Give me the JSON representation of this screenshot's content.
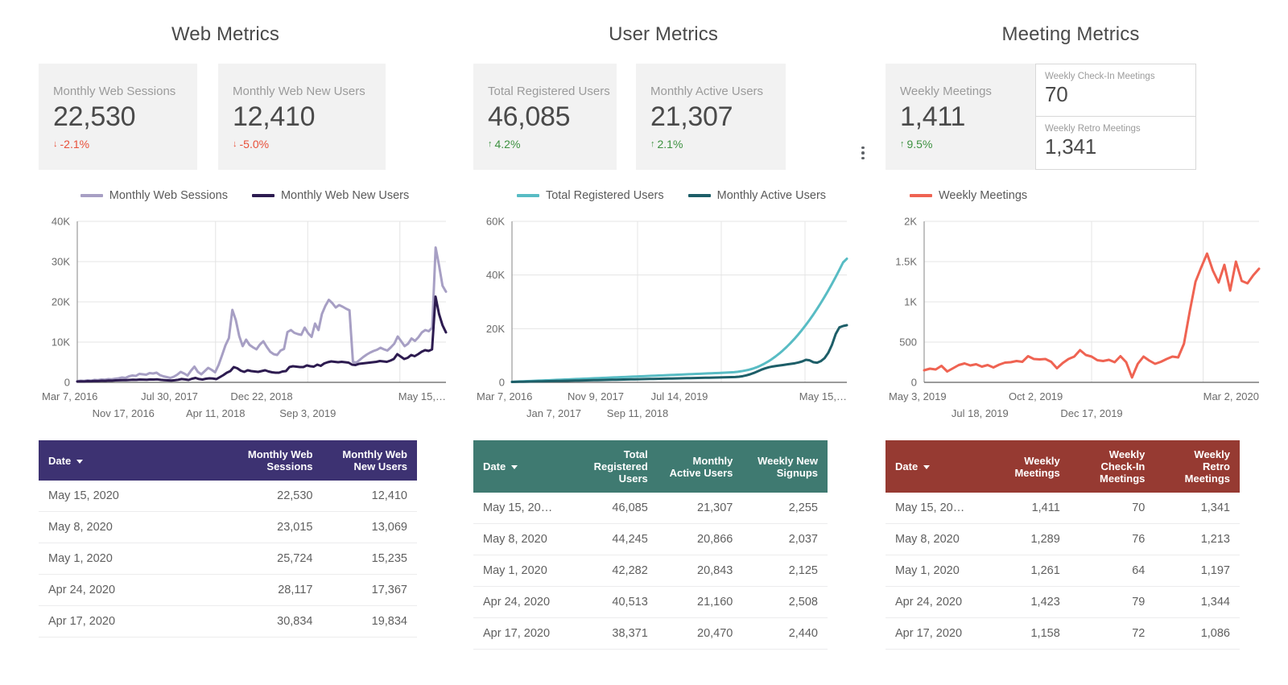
{
  "panels": [
    {
      "title": "Web Metrics",
      "scorecards": [
        {
          "label": "Monthly Web Sessions",
          "value": "22,530",
          "delta": "-2.1%",
          "direction": "down",
          "arrow": "↓"
        },
        {
          "label": "Monthly Web New Users",
          "value": "12,410",
          "delta": "-5.0%",
          "direction": "down",
          "arrow": "↓"
        }
      ],
      "legend": [
        {
          "label": "Monthly Web Sessions",
          "color": "#a79fc4"
        },
        {
          "label": "Monthly Web New Users",
          "color": "#2d1b50"
        }
      ],
      "table": {
        "header_color": "#3d3272",
        "columns": [
          "Date",
          "Monthly Web Sessions",
          "Monthly Web New Users"
        ],
        "rows": [
          [
            "May 15, 2020",
            "22,530",
            "12,410"
          ],
          [
            "May 8, 2020",
            "23,015",
            "13,069"
          ],
          [
            "May 1, 2020",
            "25,724",
            "15,235"
          ],
          [
            "Apr 24, 2020",
            "28,117",
            "17,367"
          ],
          [
            "Apr 17, 2020",
            "30,834",
            "19,834"
          ]
        ]
      }
    },
    {
      "title": "User Metrics",
      "scorecards": [
        {
          "label": "Total Registered Users",
          "value": "46,085",
          "delta": "4.2%",
          "direction": "up",
          "arrow": "↑"
        },
        {
          "label": "Monthly Active Users",
          "value": "21,307",
          "delta": "2.1%",
          "direction": "up",
          "arrow": "↑"
        }
      ],
      "legend": [
        {
          "label": "Total Registered Users",
          "color": "#58bcc4"
        },
        {
          "label": "Monthly Active Users",
          "color": "#1d5e68"
        }
      ],
      "table": {
        "header_color": "#3f7a71",
        "columns": [
          "Date",
          "Total Registered Users",
          "Monthly Active Users",
          "Weekly New Signups"
        ],
        "rows": [
          [
            "May 15, 20…",
            "46,085",
            "21,307",
            "2,255"
          ],
          [
            "May 8, 2020",
            "44,245",
            "20,866",
            "2,037"
          ],
          [
            "May 1, 2020",
            "42,282",
            "20,843",
            "2,125"
          ],
          [
            "Apr 24, 2020",
            "40,513",
            "21,160",
            "2,508"
          ],
          [
            "Apr 17, 2020",
            "38,371",
            "20,470",
            "2,440"
          ]
        ]
      }
    },
    {
      "title": "Meeting Metrics",
      "scorecards": [
        {
          "label": "Weekly Meetings",
          "value": "1,411",
          "delta": "9.5%",
          "direction": "up",
          "arrow": "↑"
        }
      ],
      "mini_cards": [
        {
          "label": "Weekly Check-In Meetings",
          "value": "70"
        },
        {
          "label": "Weekly Retro Meetings",
          "value": "1,341"
        }
      ],
      "legend": [
        {
          "label": "Weekly Meetings",
          "color": "#ef6352"
        }
      ],
      "table": {
        "header_color": "#963a32",
        "columns": [
          "Date",
          "Weekly Meetings",
          "Weekly Check-In Meetings",
          "Weekly Retro Meetings"
        ],
        "rows": [
          [
            "May 15, 20…",
            "1,411",
            "70",
            "1,341"
          ],
          [
            "May 8, 2020",
            "1,289",
            "76",
            "1,213"
          ],
          [
            "May 1, 2020",
            "1,261",
            "64",
            "1,197"
          ],
          [
            "Apr 24, 2020",
            "1,423",
            "79",
            "1,344"
          ],
          [
            "Apr 17, 2020",
            "1,158",
            "72",
            "1,086"
          ]
        ]
      }
    }
  ],
  "chart_data": [
    {
      "type": "line",
      "title": "Web Metrics",
      "xlabel": "",
      "ylabel": "",
      "ylim": [
        0,
        40000
      ],
      "yticks": [
        "0",
        "10K",
        "20K",
        "30K",
        "40K"
      ],
      "ytick_values": [
        0,
        10000,
        20000,
        30000,
        40000
      ],
      "xticks_row1": [
        "Mar 7, 2016",
        "Jul 30, 2017",
        "Dec 22, 2018",
        "May 15,…"
      ],
      "xticks_row2": [
        "Nov 17, 2016",
        "Apr 11, 2018",
        "Sep 3, 2019"
      ],
      "grid": true,
      "legend_position": "top",
      "series": [
        {
          "name": "Monthly Web Sessions",
          "color": "#a79fc4",
          "values": [
            300,
            400,
            350,
            500,
            420,
            600,
            550,
            700,
            650,
            800,
            750,
            900,
            1000,
            1200,
            1100,
            1500,
            1700,
            1600,
            2100,
            2000,
            1900,
            2300,
            2200,
            2400,
            1800,
            1500,
            1300,
            1100,
            1400,
            1900,
            2600,
            2200,
            1700,
            2900,
            3900,
            2600,
            2000,
            2800,
            3600,
            3100,
            2500,
            4300,
            6700,
            9200,
            11000,
            18000,
            15500,
            11500,
            9000,
            10600,
            9300,
            8700,
            8200,
            9400,
            10200,
            8800,
            7600,
            7000,
            6800,
            7900,
            8300,
            12500,
            13000,
            12300,
            12000,
            11800,
            13600,
            12200,
            11300,
            14600,
            13000,
            17000,
            19000,
            20500,
            19700,
            18600,
            19200,
            18800,
            18300,
            17900,
            5100,
            4900,
            5600,
            6300,
            6900,
            7400,
            7800,
            8100,
            8600,
            8200,
            7900,
            8700,
            9600,
            11400,
            10200,
            9000,
            9600,
            10900,
            10300,
            11200,
            12400,
            13000,
            12700,
            13600,
            33500,
            29000,
            24000,
            22530
          ]
        },
        {
          "name": "Monthly Web New Users",
          "color": "#2d1b50",
          "values": [
            200,
            250,
            230,
            300,
            280,
            350,
            330,
            400,
            380,
            450,
            430,
            500,
            520,
            560,
            540,
            600,
            640,
            620,
            700,
            680,
            660,
            720,
            700,
            740,
            620,
            560,
            500,
            440,
            520,
            640,
            820,
            720,
            600,
            900,
            1100,
            820,
            700,
            900,
            1000,
            950,
            800,
            1300,
            1800,
            2400,
            2800,
            3800,
            3500,
            2900,
            2600,
            3000,
            2800,
            2700,
            2600,
            2800,
            3000,
            2700,
            2500,
            2400,
            2400,
            2700,
            2800,
            3800,
            4000,
            3900,
            3800,
            3800,
            4200,
            4000,
            3900,
            4400,
            4100,
            4700,
            5000,
            5200,
            5100,
            5000,
            5100,
            5000,
            4900,
            4400,
            4300,
            4600,
            4700,
            4800,
            4900,
            5000,
            5100,
            5300,
            5200,
            5100,
            5400,
            5800,
            7000,
            6400,
            5800,
            6100,
            6800,
            6500,
            7000,
            7600,
            8000,
            7800,
            8200,
            21300,
            17000,
            14200,
            12410
          ]
        }
      ]
    },
    {
      "type": "line",
      "title": "User Metrics",
      "xlabel": "",
      "ylabel": "",
      "ylim": [
        0,
        60000
      ],
      "yticks": [
        "0",
        "20K",
        "40K",
        "60K"
      ],
      "ytick_values": [
        0,
        20000,
        40000,
        60000
      ],
      "xticks_row1": [
        "Mar 7, 2016",
        "Nov 9, 2017",
        "Jul 14, 2019",
        "May 15,…"
      ],
      "xticks_row2": [
        "Jan 7, 2017",
        "Sep 11, 2018"
      ],
      "grid": true,
      "legend_position": "top",
      "series": [
        {
          "name": "Total Registered Users",
          "color": "#58bcc4",
          "values": [
            200,
            260,
            320,
            380,
            440,
            500,
            560,
            620,
            680,
            740,
            800,
            860,
            920,
            980,
            1040,
            1100,
            1160,
            1220,
            1280,
            1340,
            1400,
            1460,
            1520,
            1580,
            1640,
            1700,
            1760,
            1820,
            1880,
            1940,
            2000,
            2060,
            2120,
            2180,
            2240,
            2300,
            2360,
            2420,
            2480,
            2540,
            2600,
            2660,
            2720,
            2780,
            2840,
            2900,
            2960,
            3020,
            3080,
            3140,
            3200,
            3260,
            3320,
            3380,
            3440,
            3500,
            3560,
            3620,
            3700,
            3800,
            3950,
            4150,
            4400,
            4700,
            5100,
            5600,
            6200,
            6900,
            7700,
            8600,
            9600,
            10700,
            11900,
            13200,
            14600,
            16100,
            17700,
            19400,
            21200,
            23100,
            25100,
            27200,
            29400,
            31700,
            34100,
            36600,
            39200,
            41900,
            44700,
            46085
          ]
        },
        {
          "name": "Monthly Active Users",
          "color": "#1d5e68",
          "values": [
            150,
            180,
            210,
            240,
            270,
            300,
            330,
            360,
            390,
            420,
            450,
            480,
            510,
            540,
            570,
            600,
            630,
            660,
            690,
            720,
            750,
            780,
            810,
            840,
            870,
            900,
            930,
            960,
            990,
            1020,
            1050,
            1080,
            1110,
            1140,
            1170,
            1200,
            1230,
            1260,
            1290,
            1320,
            1350,
            1380,
            1410,
            1440,
            1470,
            1500,
            1530,
            1560,
            1590,
            1620,
            1650,
            1680,
            1710,
            1740,
            1770,
            1800,
            1830,
            1860,
            1900,
            1950,
            2000,
            2100,
            2300,
            2600,
            3000,
            3500,
            4100,
            4700,
            5200,
            5600,
            5900,
            6100,
            6300,
            6500,
            6700,
            6900,
            7100,
            7400,
            7800,
            8400,
            8200,
            7500,
            7300,
            7900,
            9000,
            11000,
            14000,
            18000,
            20500,
            21000,
            21307
          ]
        }
      ]
    },
    {
      "type": "line",
      "title": "Meeting Metrics",
      "xlabel": "",
      "ylabel": "",
      "ylim": [
        0,
        2000
      ],
      "yticks": [
        "0",
        "500",
        "1K",
        "1.5K",
        "2K"
      ],
      "ytick_values": [
        0,
        500,
        1000,
        1500,
        2000
      ],
      "xticks_row1": [
        "May 3, 2019",
        "Oct 2, 2019",
        "Mar 2, 2020"
      ],
      "xticks_row2": [
        "Jul 18, 2019",
        "Dec 17, 2019"
      ],
      "grid": true,
      "legend_position": "top",
      "series": [
        {
          "name": "Weekly Meetings",
          "color": "#ef6352",
          "values": [
            150,
            170,
            160,
            205,
            135,
            175,
            215,
            235,
            210,
            225,
            195,
            215,
            185,
            220,
            245,
            250,
            265,
            255,
            325,
            290,
            285,
            290,
            255,
            175,
            240,
            290,
            320,
            400,
            340,
            320,
            275,
            265,
            280,
            250,
            325,
            250,
            60,
            230,
            320,
            270,
            230,
            255,
            290,
            320,
            310,
            480,
            880,
            1250,
            1430,
            1600,
            1390,
            1240,
            1460,
            1140,
            1500,
            1260,
            1230,
            1330,
            1411
          ]
        }
      ]
    }
  ]
}
